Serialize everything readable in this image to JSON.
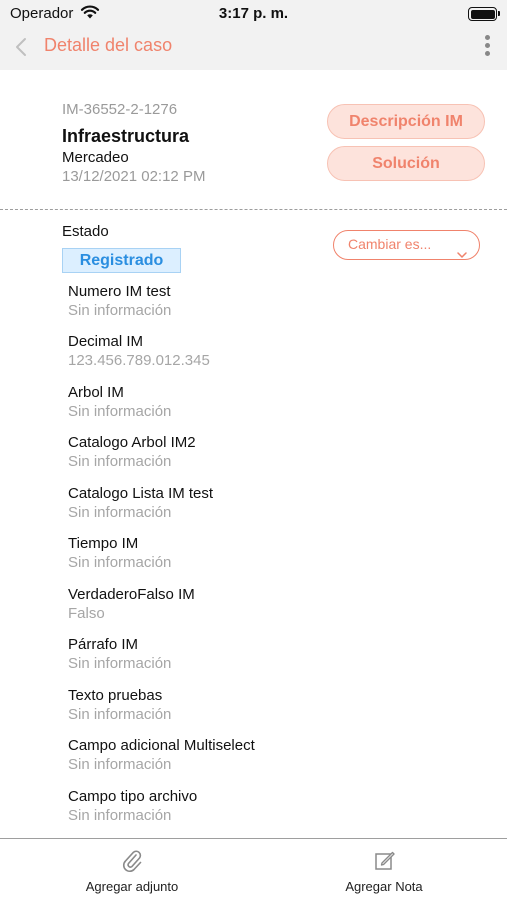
{
  "status_bar": {
    "carrier": "Operador",
    "time": "3:17 p. m."
  },
  "nav": {
    "title": "Detalle del caso"
  },
  "case": {
    "id": "IM-36552-2-1276",
    "title": "Infraestructura",
    "area": "Mercadeo",
    "date": "13/12/2021 02:12 PM"
  },
  "buttons": {
    "description": "Descripción IM",
    "solution": "Solución"
  },
  "state": {
    "label": "Estado",
    "value": "Registrado",
    "change": "Cambiar es..."
  },
  "fields": [
    {
      "label": "Numero IM test",
      "value": "Sin información"
    },
    {
      "label": "Decimal IM",
      "value": "123.456.789.012.345"
    },
    {
      "label": "Arbol IM",
      "value": "Sin información"
    },
    {
      "label": "Catalogo Arbol IM2",
      "value": "Sin información"
    },
    {
      "label": "Catalogo Lista IM test",
      "value": "Sin información"
    },
    {
      "label": "Tiempo IM",
      "value": "Sin información"
    },
    {
      "label": "VerdaderoFalso IM",
      "value": "Falso"
    },
    {
      "label": "Párrafo IM",
      "value": "Sin información"
    },
    {
      "label": "Texto pruebas",
      "value": "Sin información"
    },
    {
      "label": "Campo adicional Multiselect",
      "value": "Sin información"
    },
    {
      "label": "Campo tipo archivo",
      "value": "Sin información"
    }
  ],
  "tabs": {
    "attach": "Agregar adjunto",
    "note": "Agregar Nota"
  },
  "colors": {
    "accent": "#f0836c",
    "badge_blue": "#2a8ee0",
    "muted": "#a6a6a6"
  },
  "icons": [
    "wifi-icon",
    "battery-icon",
    "chevron-left-icon",
    "more-vertical-icon",
    "chevron-down-icon",
    "paperclip-icon",
    "edit-note-icon"
  ]
}
